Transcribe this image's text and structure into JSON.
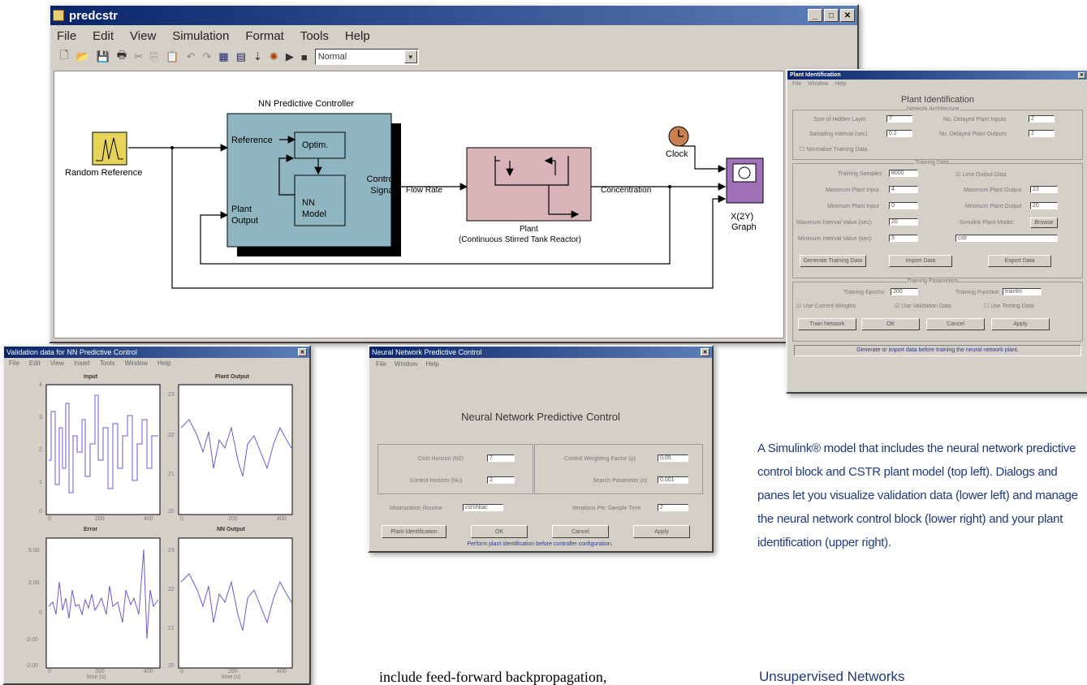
{
  "main_window": {
    "title": "predcstr",
    "menu": [
      "File",
      "Edit",
      "View",
      "Simulation",
      "Format",
      "Tools",
      "Help"
    ],
    "sim_mode": "Normal"
  },
  "diagram": {
    "random_reference": "Random Reference",
    "nnpc_title": "NN Predictive Controller",
    "reference": "Reference",
    "optim": "Optim.",
    "nn_model": "NN Model",
    "plant_output": "Plant Output",
    "control_signal": "Control Signal",
    "flow_rate": "Flow Rate",
    "plant": "Plant",
    "plant_sub": "(Continuous Stirred Tank Reactor)",
    "concentration": "Concentration",
    "clock": "Clock",
    "graph_name": "X(2Y)",
    "graph": "Graph"
  },
  "plant_id": {
    "title": "Plant Identification",
    "menu": [
      "File",
      "Window",
      "Help"
    ],
    "heading": "Plant Identification",
    "grp1": "Network Architecture",
    "f_hidden": "Size of Hidden Layer",
    "v_hidden": "7",
    "f_delayed_in": "No. Delayed Plant Inputs",
    "v_delayed_in": "2",
    "f_interval": "Sampling Interval (sec)",
    "v_interval": "0.2",
    "f_delayed_out": "No. Delayed Plant Outputs",
    "v_delayed_out": "2",
    "f_normalize": "Normalize Training Data",
    "grp2": "Training Data",
    "f_samples": "Training Samples",
    "v_samples": "8000",
    "f_limit": "Limit Output Data",
    "f_max_in": "Maximum Plant Input",
    "v_max_in": "4",
    "f_max_out": "Maximum Plant Output",
    "v_max_out": "23",
    "f_min_in": "Minimum Plant Input",
    "v_min_in": "0",
    "f_min_out": "Minimum Plant Output",
    "v_min_out": "20",
    "f_max_int": "Maximum Interval Value (sec)",
    "v_max_int": "20",
    "f_model": "Simulink Plant Model:",
    "browse": "Browse",
    "f_min_int": "Minimum Interval Value (sec)",
    "v_min_int": "5",
    "v_model": "cstr",
    "gen": "Generate Training Data",
    "import": "Import Data",
    "export": "Export Data",
    "grp3": "Training Parameters",
    "f_epochs": "Training Epochs",
    "v_epochs": "200",
    "f_func": "Training Function",
    "v_func": "trainlm",
    "c1": "Use Current Weights",
    "c2": "Use Validation Data",
    "c3": "Use Testing Data",
    "b1": "Train Network",
    "b2": "OK",
    "b3": "Cancel",
    "b4": "Apply",
    "status": "Generate or import data before training the neural network plant."
  },
  "validation": {
    "title": "Validation data for NN Predictive Control",
    "menu": [
      "File",
      "Edit",
      "View",
      "Insert",
      "Tools",
      "Window",
      "Help"
    ],
    "p1": "Input",
    "p2": "Plant Output",
    "p3": "Error",
    "p4": "NN Output",
    "xlabel": "time (s)",
    "t1": [
      "4",
      "3",
      "2",
      "1",
      "0"
    ],
    "t2": [
      "23",
      "22",
      "21",
      "20"
    ],
    "t3": [
      "5.00",
      "2.00",
      "0",
      "-2.00",
      "-2.00"
    ],
    "t4": [
      "23",
      "22",
      "21",
      "20"
    ],
    "xt": [
      "0",
      "200",
      "400"
    ],
    "xt2": [
      "0",
      "200",
      "400"
    ]
  },
  "nnpc": {
    "title": "Neural Network Predictive Control",
    "menu": [
      "File",
      "Window",
      "Help"
    ],
    "heading": "Neural Network Predictive Control",
    "f_costh": "Cost Horizon (N2)",
    "v_costh": "7",
    "f_ctrlh": "Control Horizon (Nu)",
    "v_ctrlh": "2",
    "f_cw": "Control Weighting Factor (ρ)",
    "v_cw": "0.05",
    "f_sp": "Search Parameter (α)",
    "v_sp": "0.001",
    "f_min": "Minimization Routine",
    "v_min": "csrchbac",
    "f_iter": "Iterations Per Sample Time",
    "v_iter": "2",
    "b1": "Plant Identification",
    "b2": "OK",
    "b3": "Cancel",
    "b4": "Apply",
    "status": "Perform plant identification before controller configuration."
  },
  "caption": [
    "A Simulink® model that includes the neural network predictive",
    "control block and CSTR plant model (top left). Dialogs and",
    "panes let you visualize validation data (lower left) and manage",
    "the neural network control block (lower right) and your plant",
    "identification (upper right)."
  ],
  "body_text": "include feed-forward backpropagation,",
  "heading": "Unsupervised Networks",
  "colors": {
    "title": "#0a246a",
    "block_teal": "#8fb6c0",
    "block_pink": "#d8b4b8",
    "caption": "#1e3a78"
  }
}
